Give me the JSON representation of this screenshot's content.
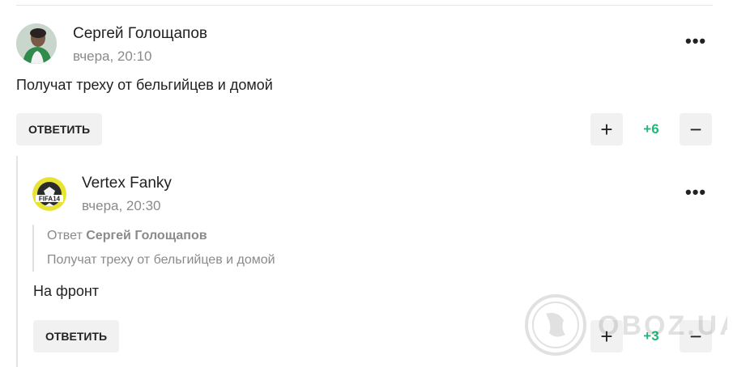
{
  "comments": [
    {
      "author": "Сергей Голощапов",
      "time": "вчера, 20:10",
      "text": "Получат треху от бельгийцев и домой",
      "reply_label": "ОТВЕТИТЬ",
      "score": "+6",
      "upvote": "+",
      "downvote": "−",
      "more": "•••"
    },
    {
      "author": "Vertex Fanky",
      "time": "вчера, 20:30",
      "quote_prefix": "Ответ",
      "quote_author": "Сергей Голощапов",
      "quote_text": "Получат треху от бельгийцев и домой",
      "text": "На фронт",
      "reply_label": "ОТВЕТИТЬ",
      "score": "+3",
      "upvote": "+",
      "downvote": "−",
      "more": "•••"
    }
  ],
  "avatar2_text": "FIFA14",
  "watermark": "OBOZ.UA",
  "colors": {
    "score": "#1fb87a",
    "button_bg": "#f1f1f1",
    "muted": "#8a8a8a"
  }
}
